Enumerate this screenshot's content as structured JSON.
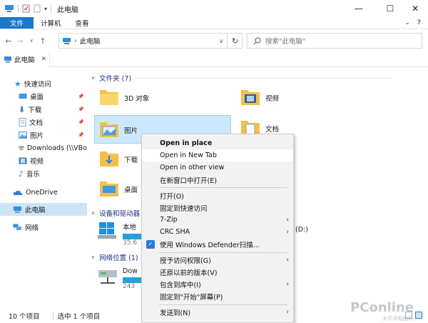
{
  "window": {
    "title": "此电脑",
    "minimize_glyph": "—",
    "maximize_glyph": "☐",
    "close_glyph": "✕"
  },
  "ribbon": {
    "tabs": [
      "文件",
      "计算机",
      "查看"
    ],
    "expand_glyph": "⌄",
    "help_glyph": "?"
  },
  "address": {
    "path": "此电脑",
    "separator": "›",
    "search_placeholder": "搜索\"此电脑\""
  },
  "tab": {
    "label": "此电脑",
    "close": "✕"
  },
  "nav": {
    "items": [
      {
        "label": "快速访问",
        "icon": "star-icon"
      },
      {
        "label": "桌面",
        "icon": "desktop-icon",
        "pinned": true
      },
      {
        "label": "下载",
        "icon": "download-icon",
        "pinned": true
      },
      {
        "label": "文档",
        "icon": "document-icon",
        "pinned": true
      },
      {
        "label": "图片",
        "icon": "pictures-icon",
        "pinned": true
      },
      {
        "label": "Downloads (\\\\VBo",
        "icon": "folder-icon"
      },
      {
        "label": "视频",
        "icon": "video-icon"
      },
      {
        "label": "音乐",
        "icon": "music-icon"
      },
      {
        "label": "OneDrive",
        "icon": "cloud-icon"
      },
      {
        "label": "此电脑",
        "icon": "computer-icon"
      },
      {
        "label": "网络",
        "icon": "network-icon"
      }
    ]
  },
  "content": {
    "folders_header": "文件夹 (7)",
    "folders": [
      "3D 对象",
      "视频",
      "图片",
      "文档",
      "下载",
      "桌面"
    ],
    "devices_header": "设备和驱动器",
    "drive1_label": "本地",
    "drive1_sub": "35.6",
    "drive2_label": "(D:)",
    "network_header": "网络位置 (1)",
    "net_label": "Dow",
    "net_sub": "243"
  },
  "status": {
    "count": "10 个项目",
    "selected": "选中 1 个项目"
  },
  "watermark": {
    "main": "PConline",
    "sub": "太平洋电脑网"
  },
  "context_menu": {
    "items": [
      {
        "label": "Open in place",
        "bold": true
      },
      {
        "label": "Open in New Tab",
        "highlight": true
      },
      {
        "label": "Open in other view"
      },
      {
        "label": "在新窗口中打开(E)"
      },
      {
        "label": "打开(O)"
      },
      {
        "label": "固定到快速访问"
      },
      {
        "label": "7-Zip",
        "submenu": true
      },
      {
        "label": "CRC SHA",
        "submenu": true
      },
      {
        "label": "使用 Windows Defender扫描...",
        "icon": "shield-icon"
      },
      {
        "label": "授予访问权限(G)",
        "submenu": true
      },
      {
        "label": "还原以前的版本(V)"
      },
      {
        "label": "包含到库中(I)",
        "submenu": true
      },
      {
        "label": "固定到\"开始\"屏幕(P)"
      },
      {
        "label": "发送到(N)",
        "submenu": true
      }
    ],
    "arrow": "›"
  },
  "colors": {
    "accent": "#1979ca",
    "selection": "#cce8ff",
    "progress": "#26a0da",
    "folder": "#f5c04a"
  }
}
